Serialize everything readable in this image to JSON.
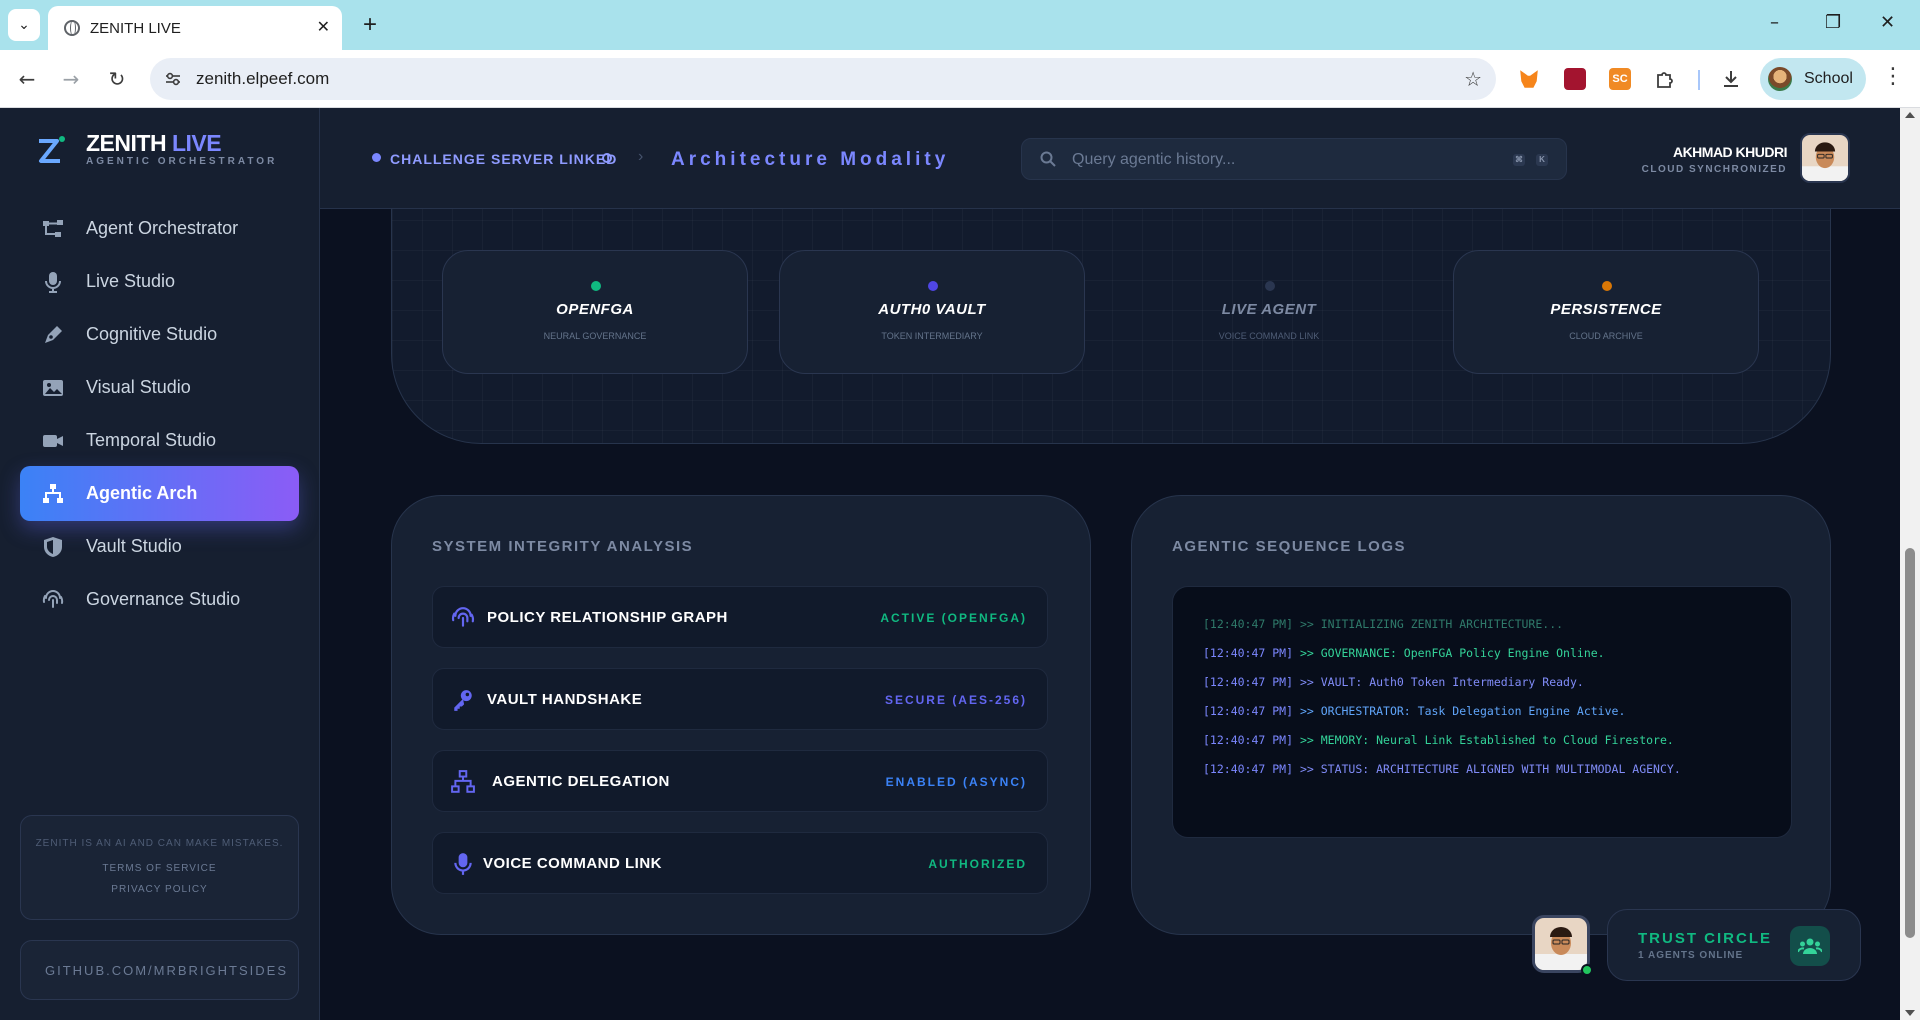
{
  "browser": {
    "tab_title": "ZENITH LIVE",
    "url": "zenith.elpeef.com",
    "profile_label": "School",
    "extensions": [
      "metamask-icon",
      "mendeley-icon",
      "sc-extension-icon",
      "puzzle-icon"
    ]
  },
  "brand": {
    "name_main": "ZENITH",
    "name_accent": "LIVE",
    "subtitle": "AGENTIC ORCHESTRATOR"
  },
  "sidebar": {
    "items": [
      {
        "label": "Agent Orchestrator",
        "icon": "orchestrator-icon",
        "active": false
      },
      {
        "label": "Live Studio",
        "icon": "microphone-icon",
        "active": false
      },
      {
        "label": "Cognitive Studio",
        "icon": "pen-icon",
        "active": false
      },
      {
        "label": "Visual Studio",
        "icon": "image-icon",
        "active": false
      },
      {
        "label": "Temporal Studio",
        "icon": "video-icon",
        "active": false
      },
      {
        "label": "Agentic Arch",
        "icon": "sitemap-icon",
        "active": true
      },
      {
        "label": "Vault Studio",
        "icon": "shield-icon",
        "active": false
      },
      {
        "label": "Governance Studio",
        "icon": "fingerprint-icon",
        "active": false
      }
    ],
    "disclaimer": "ZENITH IS AN AI AND CAN MAKE MISTAKES.",
    "terms": "TERMS OF SERVICE",
    "privacy": "PRIVACY POLICY",
    "github": "GITHUB.COM/MRBRIGHTSIDES"
  },
  "header": {
    "server_status": "CHALLENGE SERVER LINKED",
    "modality": "Architecture Modality",
    "search_placeholder": "Query agentic history...",
    "shortcut_keys": [
      "⌘",
      "K"
    ],
    "user_name": "AKHMAD KHUDRI",
    "user_status": "CLOUD SYNCHRONIZED"
  },
  "architecture_nodes": [
    {
      "title": "OPENFGA",
      "subtitle": "NEURAL GOVERNANCE",
      "dot_color": "#10b981",
      "dimmed": false
    },
    {
      "title": "AUTH0 VAULT",
      "subtitle": "TOKEN INTERMEDIARY",
      "dot_color": "#4f46e5",
      "dimmed": false
    },
    {
      "title": "LIVE AGENT",
      "subtitle": "VOICE COMMAND LINK",
      "dot_color": "#2a3650",
      "dimmed": true
    },
    {
      "title": "PERSISTENCE",
      "subtitle": "CLOUD ARCHIVE",
      "dot_color": "#d97706",
      "dimmed": false
    }
  ],
  "integrity": {
    "title": "SYSTEM INTEGRITY ANALYSIS",
    "rows": [
      {
        "label": "POLICY RELATIONSHIP GRAPH",
        "status": "ACTIVE (OPENFGA)",
        "icon": "fingerprint-icon",
        "status_color": "#10b981"
      },
      {
        "label": "VAULT HANDSHAKE",
        "status": "SECURE (AES-256)",
        "icon": "key-icon",
        "status_color": "#6366f1"
      },
      {
        "label": "AGENTIC DELEGATION",
        "status": "ENABLED (ASYNC)",
        "icon": "sitemap-icon",
        "status_color": "#3b82f6"
      },
      {
        "label": "VOICE COMMAND LINK",
        "status": "AUTHORIZED",
        "icon": "microphone-icon",
        "status_color": "#10b981"
      }
    ]
  },
  "logs": {
    "title": "AGENTIC SEQUENCE LOGS",
    "lines": [
      {
        "time": "[12:40:47 PM]",
        "text": ">> INITIALIZING ZENITH ARCHITECTURE...",
        "color": "#2f7a6a",
        "dim": true
      },
      {
        "time": "[12:40:47 PM]",
        "text": ">> GOVERNANCE: OpenFGA Policy Engine Online.",
        "color": "#34d399",
        "dim": false
      },
      {
        "time": "[12:40:47 PM]",
        "text": ">> VAULT: Auth0 Token Intermediary Ready.",
        "color": "#818cf8",
        "dim": false
      },
      {
        "time": "[12:40:47 PM]",
        "text": ">> ORCHESTRATOR: Task Delegation Engine Active.",
        "color": "#60a5fa",
        "dim": false
      },
      {
        "time": "[12:40:47 PM]",
        "text": ">> MEMORY: Neural Link Established to Cloud Firestore.",
        "color": "#34d399",
        "dim": false
      },
      {
        "time": "[12:40:47 PM]",
        "text": ">> STATUS: ARCHITECTURE ALIGNED WITH MULTIMODAL AGENCY.",
        "color": "#818cf8",
        "dim": false
      }
    ]
  },
  "trust_circle": {
    "title": "TRUST CIRCLE",
    "subtitle": "1 AGENTS ONLINE"
  },
  "colors": {
    "accent": "#7b87ff",
    "active_gradient_start": "#3b82f6",
    "active_gradient_end": "#8b5cf6",
    "success": "#10b981"
  }
}
